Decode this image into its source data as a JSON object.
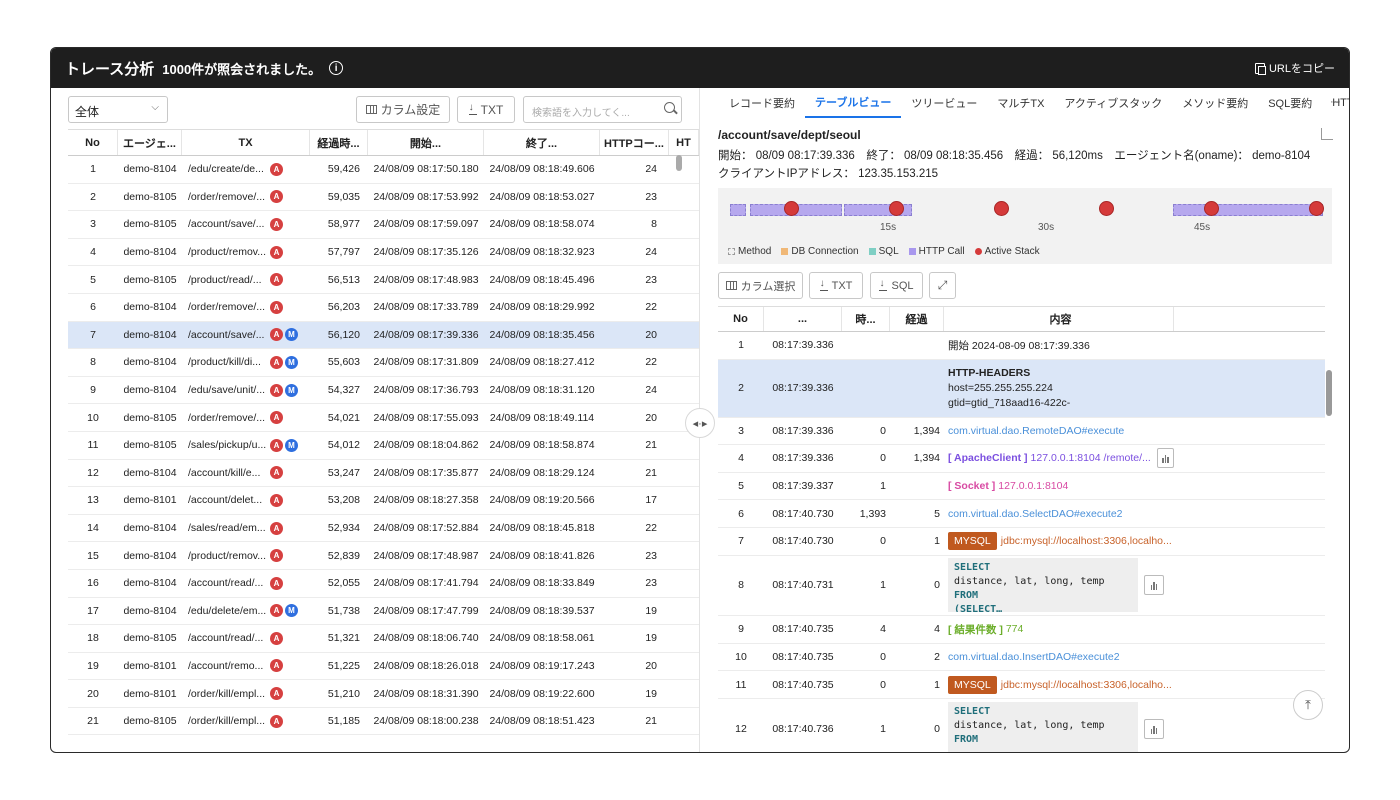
{
  "title": "トレース分析",
  "subtitle": "1000件が照会されました。",
  "copy_url": "URLをコピー",
  "left": {
    "filter_value": "全体",
    "column_btn": "カラム設定",
    "txt_btn": "TXT",
    "search_placeholder": "検索語を入力してく...",
    "headers": [
      "No",
      "エージェ...",
      "TX",
      "経過時...",
      "開始...",
      "終了...",
      "HTTPコー...",
      "HT"
    ],
    "rows": [
      {
        "no": "1",
        "agent": "demo-8104",
        "tx": "/edu/create/de...",
        "badges": [
          "A"
        ],
        "elapsed": "59,426",
        "start": "24/08/09 08:17:50.180",
        "end": "24/08/09 08:18:49.606",
        "http": "24"
      },
      {
        "no": "2",
        "agent": "demo-8105",
        "tx": "/order/remove/...",
        "badges": [
          "A"
        ],
        "elapsed": "59,035",
        "start": "24/08/09 08:17:53.992",
        "end": "24/08/09 08:18:53.027",
        "http": "23"
      },
      {
        "no": "3",
        "agent": "demo-8105",
        "tx": "/account/save/...",
        "badges": [
          "A"
        ],
        "elapsed": "58,977",
        "start": "24/08/09 08:17:59.097",
        "end": "24/08/09 08:18:58.074",
        "http": "8"
      },
      {
        "no": "4",
        "agent": "demo-8104",
        "tx": "/product/remov...",
        "badges": [
          "A"
        ],
        "elapsed": "57,797",
        "start": "24/08/09 08:17:35.126",
        "end": "24/08/09 08:18:32.923",
        "http": "24"
      },
      {
        "no": "5",
        "agent": "demo-8105",
        "tx": "/product/read/...",
        "badges": [
          "A"
        ],
        "elapsed": "56,513",
        "start": "24/08/09 08:17:48.983",
        "end": "24/08/09 08:18:45.496",
        "http": "23"
      },
      {
        "no": "6",
        "agent": "demo-8104",
        "tx": "/order/remove/...",
        "badges": [
          "A"
        ],
        "elapsed": "56,203",
        "start": "24/08/09 08:17:33.789",
        "end": "24/08/09 08:18:29.992",
        "http": "22"
      },
      {
        "no": "7",
        "agent": "demo-8104",
        "tx": "/account/save/...",
        "badges": [
          "A",
          "M"
        ],
        "elapsed": "56,120",
        "start": "24/08/09 08:17:39.336",
        "end": "24/08/09 08:18:35.456",
        "http": "20",
        "selected": true
      },
      {
        "no": "8",
        "agent": "demo-8104",
        "tx": "/product/kill/di...",
        "badges": [
          "A",
          "M"
        ],
        "elapsed": "55,603",
        "start": "24/08/09 08:17:31.809",
        "end": "24/08/09 08:18:27.412",
        "http": "22"
      },
      {
        "no": "9",
        "agent": "demo-8104",
        "tx": "/edu/save/unit/...",
        "badges": [
          "A",
          "M"
        ],
        "elapsed": "54,327",
        "start": "24/08/09 08:17:36.793",
        "end": "24/08/09 08:18:31.120",
        "http": "24"
      },
      {
        "no": "10",
        "agent": "demo-8105",
        "tx": "/order/remove/...",
        "badges": [
          "A"
        ],
        "elapsed": "54,021",
        "start": "24/08/09 08:17:55.093",
        "end": "24/08/09 08:18:49.114",
        "http": "20"
      },
      {
        "no": "11",
        "agent": "demo-8105",
        "tx": "/sales/pickup/u...",
        "badges": [
          "A",
          "M"
        ],
        "elapsed": "54,012",
        "start": "24/08/09 08:18:04.862",
        "end": "24/08/09 08:18:58.874",
        "http": "21"
      },
      {
        "no": "12",
        "agent": "demo-8104",
        "tx": "/account/kill/e...",
        "badges": [
          "A"
        ],
        "elapsed": "53,247",
        "start": "24/08/09 08:17:35.877",
        "end": "24/08/09 08:18:29.124",
        "http": "21"
      },
      {
        "no": "13",
        "agent": "demo-8101",
        "tx": "/account/delet...",
        "badges": [
          "A"
        ],
        "elapsed": "53,208",
        "start": "24/08/09 08:18:27.358",
        "end": "24/08/09 08:19:20.566",
        "http": "17"
      },
      {
        "no": "14",
        "agent": "demo-8104",
        "tx": "/sales/read/em...",
        "badges": [
          "A"
        ],
        "elapsed": "52,934",
        "start": "24/08/09 08:17:52.884",
        "end": "24/08/09 08:18:45.818",
        "http": "22"
      },
      {
        "no": "15",
        "agent": "demo-8104",
        "tx": "/product/remov...",
        "badges": [
          "A"
        ],
        "elapsed": "52,839",
        "start": "24/08/09 08:17:48.987",
        "end": "24/08/09 08:18:41.826",
        "http": "23"
      },
      {
        "no": "16",
        "agent": "demo-8104",
        "tx": "/account/read/...",
        "badges": [
          "A"
        ],
        "elapsed": "52,055",
        "start": "24/08/09 08:17:41.794",
        "end": "24/08/09 08:18:33.849",
        "http": "23"
      },
      {
        "no": "17",
        "agent": "demo-8104",
        "tx": "/edu/delete/em...",
        "badges": [
          "A",
          "M"
        ],
        "elapsed": "51,738",
        "start": "24/08/09 08:17:47.799",
        "end": "24/08/09 08:18:39.537",
        "http": "19"
      },
      {
        "no": "18",
        "agent": "demo-8105",
        "tx": "/account/read/...",
        "badges": [
          "A"
        ],
        "elapsed": "51,321",
        "start": "24/08/09 08:18:06.740",
        "end": "24/08/09 08:18:58.061",
        "http": "19"
      },
      {
        "no": "19",
        "agent": "demo-8101",
        "tx": "/account/remo...",
        "badges": [
          "A"
        ],
        "elapsed": "51,225",
        "start": "24/08/09 08:18:26.018",
        "end": "24/08/09 08:19:17.243",
        "http": "20"
      },
      {
        "no": "20",
        "agent": "demo-8101",
        "tx": "/order/kill/empl...",
        "badges": [
          "A"
        ],
        "elapsed": "51,210",
        "start": "24/08/09 08:18:31.390",
        "end": "24/08/09 08:19:22.600",
        "http": "19"
      },
      {
        "no": "21",
        "agent": "demo-8105",
        "tx": "/order/kill/empl...",
        "badges": [
          "A"
        ],
        "elapsed": "51,185",
        "start": "24/08/09 08:18:00.238",
        "end": "24/08/09 08:18:51.423",
        "http": "21"
      }
    ]
  },
  "right": {
    "tabs": [
      "レコード要約",
      "テーブルビュー",
      "ツリービュー",
      "マルチTX",
      "アクティブスタック",
      "メソッド要約",
      "SQL要約",
      "HTTP"
    ],
    "active_tab": "テーブルビュー",
    "more": "···",
    "path": "/account/save/dept/seoul",
    "meta1": "開始： 08/09 08:17:39.336　終了： 08/09 08:18:35.456　経過： 56,120ms　エージェント名(oname)： demo-8104",
    "meta2": "クライアントIPアドレス： 123.35.153.215",
    "timeline": {
      "ticks": [
        "15s",
        "30s",
        "45s"
      ],
      "legend": [
        "Method",
        "DB Connection",
        "SQL",
        "HTTP Call",
        "Active Stack"
      ],
      "legend_colors": [
        "#bbbbbb",
        "#f0b877",
        "#7fcfc4",
        "#a998ee",
        "#d53a3a"
      ]
    },
    "column_select": "カラム選択",
    "txt": "TXT",
    "sql": "SQL",
    "headers": [
      "No",
      "...",
      "時...",
      "経過",
      "内容",
      ""
    ],
    "rows": [
      {
        "no": "1",
        "time": "08:17:39.336",
        "a": "",
        "b": "",
        "kind": "plain",
        "text": "開始  2024-08-09 08:17:39.336"
      },
      {
        "no": "2",
        "time": "08:17:39.336",
        "a": "",
        "b": "",
        "kind": "headers",
        "title": "HTTP-HEADERS",
        "line1": "host=255.255.255.224",
        "line2": "gtid=gtid_718aad16-422c-",
        "selected": true
      },
      {
        "no": "3",
        "time": "08:17:39.336",
        "a": "0",
        "b": "1,394",
        "kind": "blue",
        "text": "com.virtual.dao.RemoteDAO#execute"
      },
      {
        "no": "4",
        "time": "08:17:39.336",
        "a": "0",
        "b": "1,394",
        "kind": "apache",
        "label": "[ ApacheClient ]",
        "text": "127.0.0.1:8104 /remote/..."
      },
      {
        "no": "5",
        "time": "08:17:39.337",
        "a": "1",
        "b": "",
        "kind": "socket",
        "label": "[ Socket ]",
        "text": "127.0.0.1:8104"
      },
      {
        "no": "6",
        "time": "08:17:40.730",
        "a": "1,393",
        "b": "5",
        "kind": "blue",
        "text": "com.virtual.dao.SelectDAO#execute2"
      },
      {
        "no": "7",
        "time": "08:17:40.730",
        "a": "0",
        "b": "1",
        "kind": "mysql",
        "label": "MYSQL",
        "text": "jdbc:mysql://localhost:3306,localho..."
      },
      {
        "no": "8",
        "time": "08:17:40.731",
        "a": "1",
        "b": "0",
        "kind": "sql",
        "l1": "SELECT",
        "l2": "distance, lat, long, temp",
        "l3": "FROM",
        "l4": "(SELECT…"
      },
      {
        "no": "9",
        "time": "08:17:40.735",
        "a": "4",
        "b": "4",
        "kind": "fetch",
        "label": "[ 結果件数 ]",
        "text": "774"
      },
      {
        "no": "10",
        "time": "08:17:40.735",
        "a": "0",
        "b": "2",
        "kind": "blue",
        "text": "com.virtual.dao.InsertDAO#execute2"
      },
      {
        "no": "11",
        "time": "08:17:40.735",
        "a": "0",
        "b": "1",
        "kind": "mysql",
        "label": "MYSQL",
        "text": "jdbc:mysql://localhost:3306,localho..."
      },
      {
        "no": "12",
        "time": "08:17:40.736",
        "a": "1",
        "b": "0",
        "kind": "sql",
        "l1": "SELECT",
        "l2": "distance, lat, long, temp",
        "l3": "FROM",
        "l4": ""
      }
    ]
  }
}
